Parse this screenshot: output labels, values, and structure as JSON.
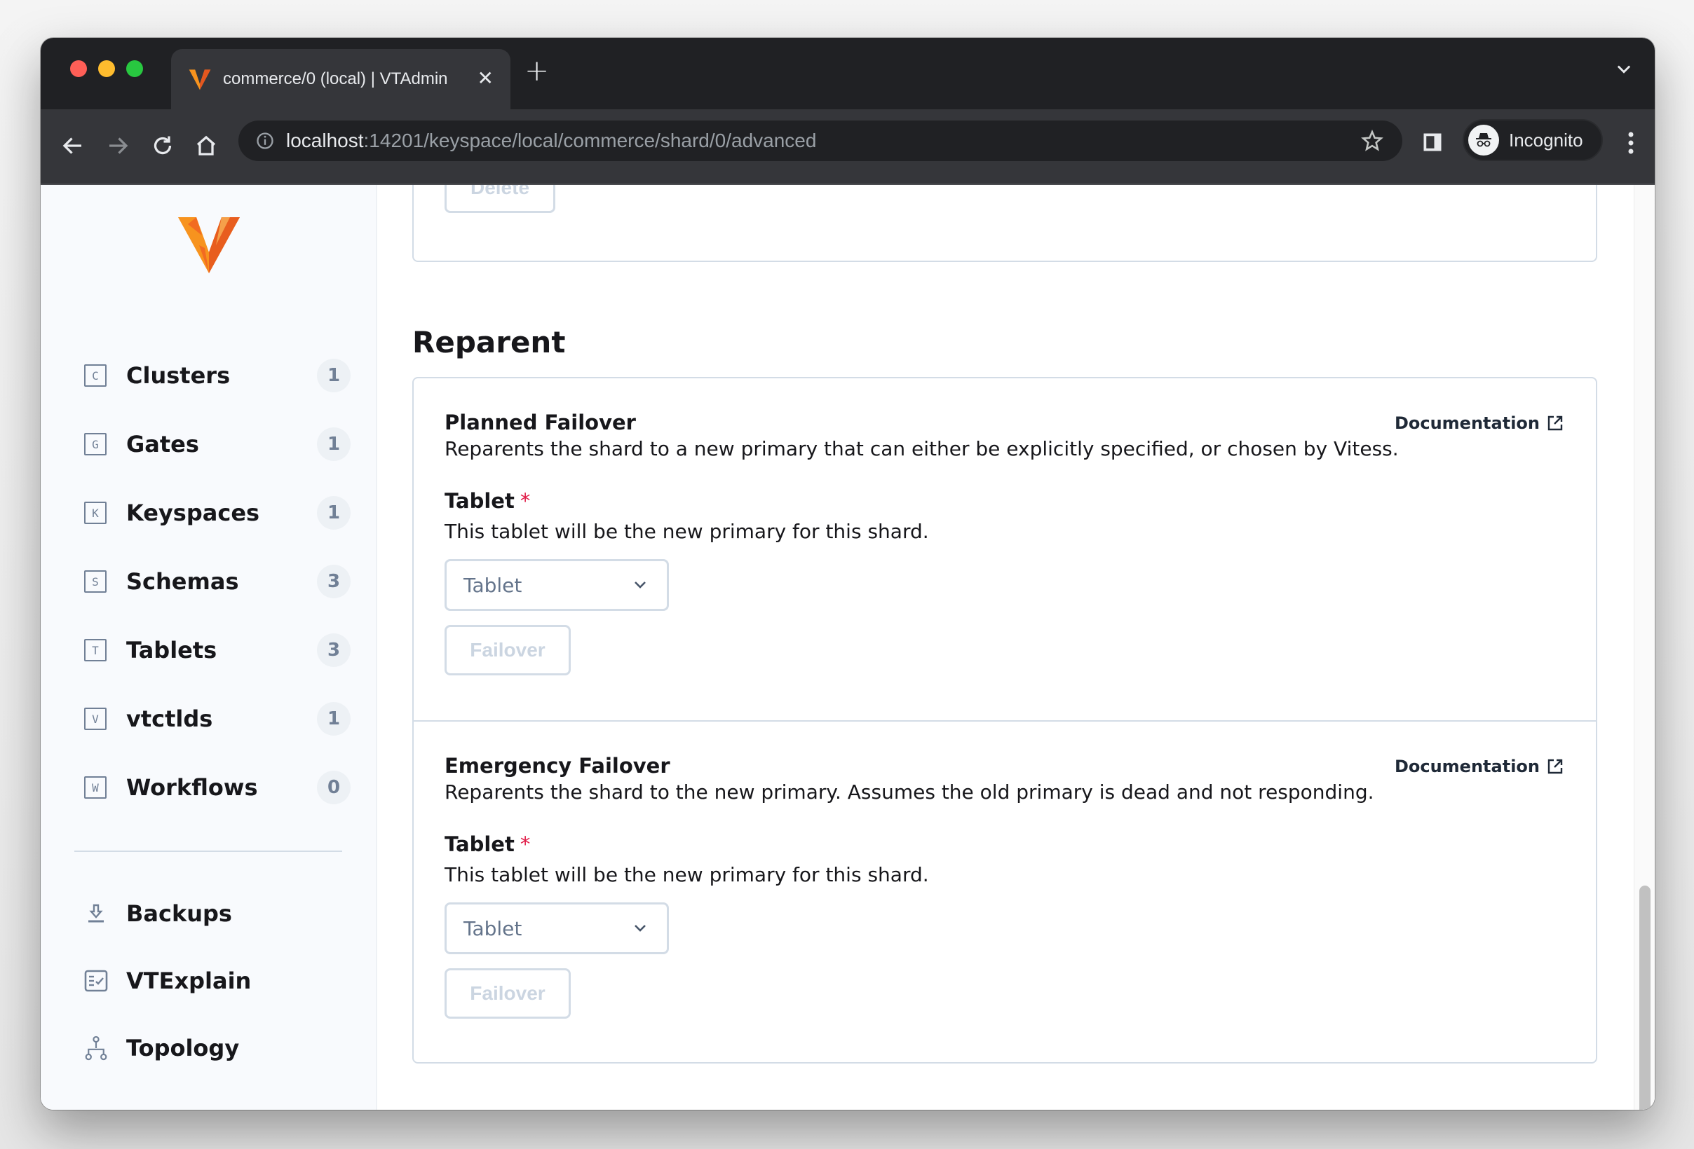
{
  "browser": {
    "tab_title": "commerce/0 (local) | VTAdmin",
    "url_host": "localhost",
    "url_path": ":14201/keyspace/local/commerce/shard/0/advanced",
    "profile_label": "Incognito",
    "icons": {
      "back": "arrow-left-icon",
      "forward": "arrow-right-icon",
      "reload": "reload-icon",
      "home": "home-icon",
      "info": "info-icon",
      "bookmark": "star-icon",
      "side_panel": "side-panel-icon",
      "incognito": "incognito-icon",
      "menu": "kebab-menu-icon",
      "tab_close": "close-icon",
      "new_tab": "plus-icon",
      "tab_search": "chevron-down-icon"
    }
  },
  "sidebar": {
    "items": [
      {
        "letter": "C",
        "label": "Clusters",
        "count": "1"
      },
      {
        "letter": "G",
        "label": "Gates",
        "count": "1"
      },
      {
        "letter": "K",
        "label": "Keyspaces",
        "count": "1"
      },
      {
        "letter": "S",
        "label": "Schemas",
        "count": "3"
      },
      {
        "letter": "T",
        "label": "Tablets",
        "count": "3"
      },
      {
        "letter": "V",
        "label": "vtctlds",
        "count": "1"
      },
      {
        "letter": "W",
        "label": "Workflows",
        "count": "0"
      }
    ],
    "secondary": [
      {
        "label": "Backups",
        "icon": "download-icon"
      },
      {
        "label": "VTExplain",
        "icon": "checklist-icon"
      },
      {
        "label": "Topology",
        "icon": "topology-icon"
      }
    ]
  },
  "main": {
    "top_card": {
      "button_label": "Delete"
    },
    "section_title": "Reparent",
    "panels": [
      {
        "title": "Planned Failover",
        "description": "Reparents the shard to a new primary that can either be explicitly specified, or chosen by Vitess.",
        "doc_link": "Documentation",
        "field_label": "Tablet",
        "required_mark": "*",
        "field_help": "This tablet will be the new primary for this shard.",
        "select_placeholder": "Tablet",
        "button_label": "Failover"
      },
      {
        "title": "Emergency Failover",
        "description": "Reparents the shard to the new primary. Assumes the old primary is dead and not responding.",
        "doc_link": "Documentation",
        "field_label": "Tablet",
        "required_mark": "*",
        "field_help": "This tablet will be the new primary for this shard.",
        "select_placeholder": "Tablet",
        "button_label": "Failover"
      }
    ]
  },
  "colors": {
    "brand_orange": "#f7931e",
    "required_red": "#e11d48",
    "border": "#d3dce6"
  }
}
